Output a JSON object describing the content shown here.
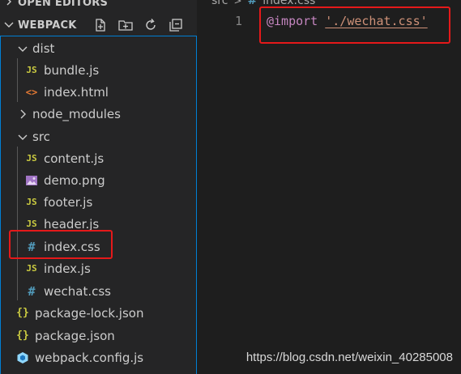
{
  "sidebar": {
    "open_editors_label": "OPEN EDITORS",
    "workspace_label": "WEBPACK",
    "toolbar": {
      "new_file_icon": "new-file-icon",
      "new_folder_icon": "new-folder-icon",
      "refresh_icon": "refresh-icon",
      "collapse_icon": "collapse-all-icon"
    },
    "tree": [
      {
        "label": "dist",
        "type": "folder",
        "expanded": true
      },
      {
        "label": "bundle.js",
        "type": "js"
      },
      {
        "label": "index.html",
        "type": "html"
      },
      {
        "label": "node_modules",
        "type": "folder",
        "expanded": false
      },
      {
        "label": "src",
        "type": "folder",
        "expanded": true
      },
      {
        "label": "content.js",
        "type": "js"
      },
      {
        "label": "demo.png",
        "type": "image"
      },
      {
        "label": "footer.js",
        "type": "js"
      },
      {
        "label": "header.js",
        "type": "js"
      },
      {
        "label": "index.css",
        "type": "css",
        "highlighted": true
      },
      {
        "label": "index.js",
        "type": "js"
      },
      {
        "label": "wechat.css",
        "type": "css"
      },
      {
        "label": "package-lock.json",
        "type": "json"
      },
      {
        "label": "package.json",
        "type": "json"
      },
      {
        "label": "webpack.config.js",
        "type": "webpack"
      }
    ],
    "icon_glyphs": {
      "js": "JS",
      "html": "<>",
      "css": "#",
      "json": "{}"
    }
  },
  "editor": {
    "breadcrumb": {
      "folder": "src",
      "separator": ">",
      "file_icon": "#",
      "file": "index.css"
    },
    "lines": [
      {
        "number": "1",
        "keyword": "@import",
        "space": " ",
        "string": "'./wechat.css'"
      }
    ]
  },
  "watermark": "https://blog.csdn.net/weixin_40285008",
  "colors": {
    "highlight": "#e5191a",
    "accent_border": "#007fd4",
    "js": "#cbcb41",
    "css": "#519aba",
    "html": "#e37933",
    "keyword": "#c586c0",
    "string": "#ce9178"
  }
}
